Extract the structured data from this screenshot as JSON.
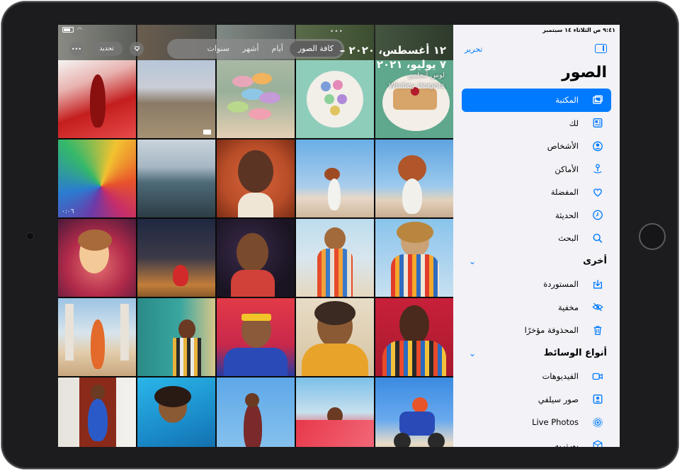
{
  "device": {
    "type": "iPad"
  },
  "status_bar": {
    "time_date": "٩:٤١ ص الثلاثاء ١٤ سبتمبر",
    "colors": {
      "accent": "#007aff"
    }
  },
  "photo_view": {
    "more_button": "•••",
    "select_label": "تحديد",
    "multitask_dots": "•••",
    "segments": [
      {
        "label": "كافة الصور",
        "active": true
      },
      {
        "label": "أيام",
        "active": false
      },
      {
        "label": "أشهر",
        "active": false
      },
      {
        "label": "سنوات",
        "active": false
      }
    ],
    "date_range_line1": "١٢ أغسطس، ٢٠٢٠ –",
    "date_range_line2": "٧ يوليو، ٢٠٢١",
    "location_line1": "لوس أنجلس",
    "location_line2": "Whitley Heights",
    "video_duration": "٠:٠٦"
  },
  "sidebar": {
    "edit_label": "تحرير",
    "title": "الصور",
    "items": [
      {
        "label": "المكتبة",
        "icon": "photo-library-icon",
        "selected": true
      },
      {
        "label": "لك",
        "icon": "for-you-icon",
        "selected": false
      },
      {
        "label": "الأشخاص",
        "icon": "person-circle-icon",
        "selected": false
      },
      {
        "label": "الأماكن",
        "icon": "map-pin-icon",
        "selected": false
      },
      {
        "label": "المفضلة",
        "icon": "heart-icon",
        "selected": false
      },
      {
        "label": "الحديثة",
        "icon": "clock-icon",
        "selected": false
      },
      {
        "label": "البحث",
        "icon": "search-icon",
        "selected": false
      }
    ],
    "section_other": {
      "label": "أخرى",
      "chevron": "chevron-down-icon"
    },
    "other_items": [
      {
        "label": "المستوردة",
        "icon": "import-icon"
      },
      {
        "label": "مخفية",
        "icon": "eye-slash-icon"
      },
      {
        "label": "المحذوفة مؤخرًا",
        "icon": "trash-icon"
      }
    ],
    "section_media": {
      "label": "أنواع الوسائط",
      "chevron": "chevron-down-icon"
    },
    "media_items": [
      {
        "label": "الفيديوهات",
        "icon": "video-icon"
      },
      {
        "label": "صور سيلفي",
        "icon": "selfie-icon"
      },
      {
        "label": "Live Photos",
        "icon": "live-photo-icon"
      },
      {
        "label": "بورتريه",
        "icon": "cube-icon"
      }
    ]
  }
}
